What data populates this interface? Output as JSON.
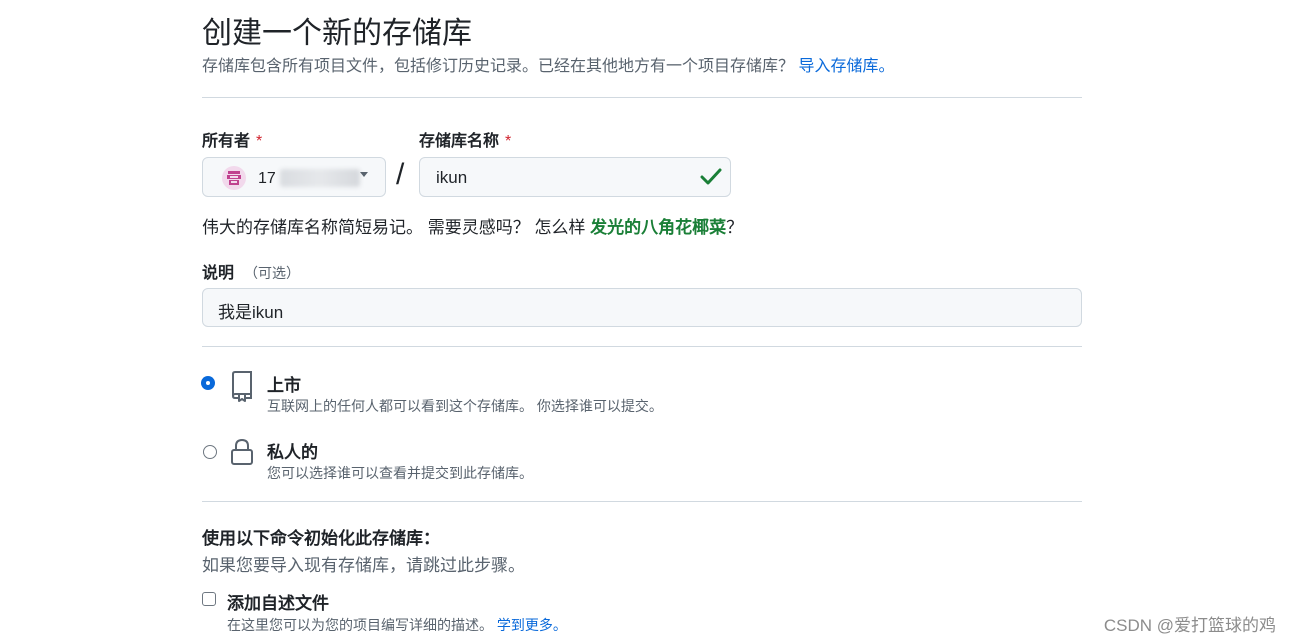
{
  "header": {
    "title": "创建一个新的存储库",
    "subtitle": "存储库包含所有项目文件，包括修订历史记录。已经在其他地方有一个项目存储库？",
    "import_link": "导入存储库。"
  },
  "owner": {
    "label": "所有者",
    "required_mark": "*",
    "value_visible": "17"
  },
  "separator": "/",
  "repo_name": {
    "label": "存储库名称",
    "required_mark": "*",
    "value": "ikun"
  },
  "name_hint": {
    "text": "伟大的存储库名称简短易记。 需要灵感吗？ 怎么样 ",
    "suggestion": "发光的八角花椰菜",
    "suffix": "？"
  },
  "description": {
    "label": "说明",
    "optional": "（可选）",
    "value": "我是ikun"
  },
  "visibility": {
    "public": {
      "title": "上市",
      "desc": "互联网上的任何人都可以看到这个存储库。 你选择谁可以提交。",
      "selected": true
    },
    "private": {
      "title": "私人的",
      "desc": "您可以选择谁可以查看并提交到此存储库。",
      "selected": false
    }
  },
  "init": {
    "title": "使用以下命令初始化此存储库：",
    "desc": "如果您要导入现有存储库，请跳过此步骤。",
    "readme_label": "添加自述文件",
    "readme_desc": "在这里您可以为您的项目编写详细的描述。",
    "learn_more": "学到更多。",
    "readme_checked": false
  },
  "watermark": "CSDN @爱打篮球的鸡",
  "colors": {
    "link": "#0969da",
    "success": "#1a7f37",
    "required": "#d1242f"
  }
}
